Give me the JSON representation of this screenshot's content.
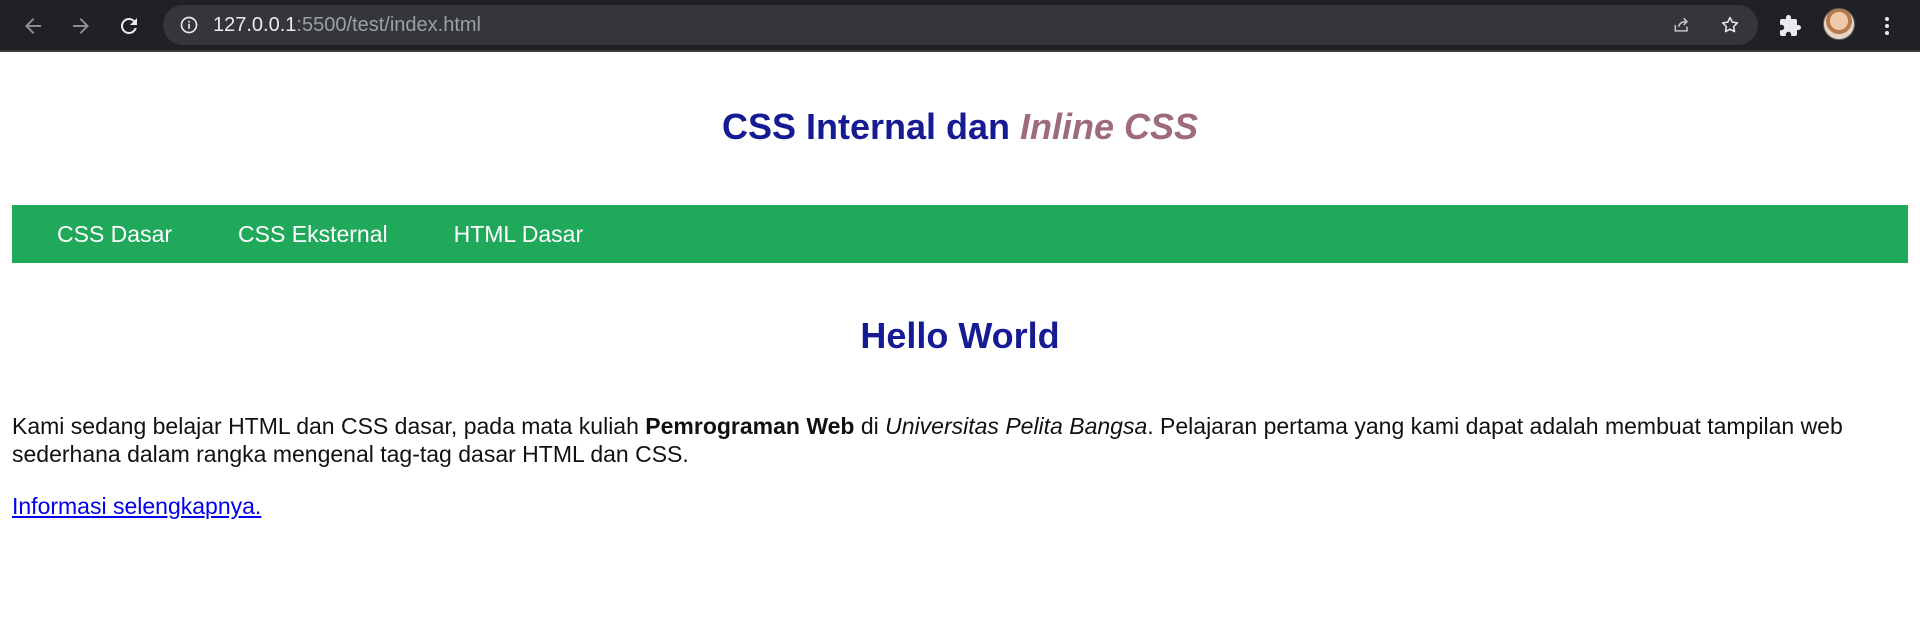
{
  "browser": {
    "url_host": "127.0.0.1",
    "url_rest": ":5500/test/index.html",
    "icons": {
      "back": "arrow-left-icon",
      "forward": "arrow-right-icon",
      "reload": "reload-icon",
      "info": "info-icon",
      "share": "share-icon",
      "bookmark": "star-icon",
      "extensions": "puzzle-icon",
      "menu": "kebab-menu-icon"
    }
  },
  "page": {
    "title_plain": "CSS Internal dan ",
    "title_accent": "Inline CSS",
    "nav": [
      {
        "label": "CSS Dasar"
      },
      {
        "label": "CSS Eksternal"
      },
      {
        "label": "HTML Dasar"
      }
    ],
    "heading": "Hello World",
    "paragraph": {
      "part1": "Kami sedang belajar HTML dan CSS dasar, pada mata kuliah ",
      "bold": "Pemrograman Web",
      "part2": " di ",
      "italic": "Universitas Pelita Bangsa",
      "part3": ". Pelajaran pertama yang kami dapat adalah membuat tampilan web sederhana dalam rangka mengenal tag-tag dasar HTML dan CSS."
    },
    "link": "Informasi selengkapnya."
  },
  "colors": {
    "title": "#161b93",
    "accent": "#a06a7e",
    "navbar": "#21a95b",
    "link": "#0000ee",
    "chrome_bg": "#202124"
  }
}
